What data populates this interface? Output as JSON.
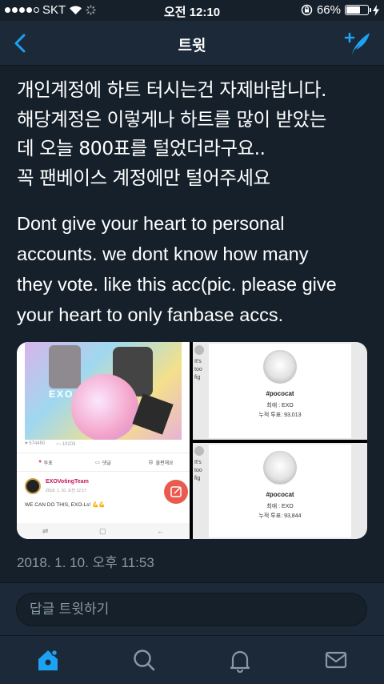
{
  "status_bar": {
    "carrier": "SKT",
    "time": "오전 12:10",
    "battery": "66%",
    "battery_level": 0.66,
    "signal_bars": 4
  },
  "nav": {
    "title": "트윗",
    "icons": {
      "back": "chevron-left-icon",
      "compose": "compose-tweet-icon"
    }
  },
  "tweet": {
    "text_ko": [
      "개인계정에 하트 터시는건 자제바랍니다.",
      "해당계정은 이렇게나 하트를 많이 받았는",
      "데 오늘 800표를 털었더라구요..",
      "꼭 팬베이스 계정에만 털어주세요"
    ],
    "text_en": [
      "Dont give your heart to personal",
      "accounts. we dont know how many",
      "they vote. like this acc(pic. please give",
      "your heart to only fanbase accs."
    ],
    "timestamp": "2018. 1. 10. 오후 11:53"
  },
  "media": {
    "left": {
      "art_label": "EXO",
      "stat_hearts": "574450",
      "stat_comments": "10103",
      "actions": [
        "투표",
        "댓글",
        "불편해요"
      ],
      "post_user": "EXOVotingTeam",
      "post_date": "2018. 1. 10. 오전 12:17",
      "post_text": "WE CAN DO THIS, EXO-Ls! 💪💪"
    },
    "right_top": {
      "handle": "#pococat",
      "bias": "최애 : EXO",
      "votes": "누적 투표: 93,013",
      "peek_lines": [
        "It's",
        "too",
        "fig"
      ]
    },
    "right_bottom": {
      "handle": "#pococat",
      "bias": "최애 : EXO",
      "votes": "누적 투표: 93,844",
      "peek_lines": [
        "It's",
        "too",
        "fig"
      ]
    }
  },
  "reply": {
    "placeholder": "답글 트윗하기"
  },
  "tabs": [
    "home-icon",
    "search-icon",
    "notifications-bell-icon",
    "messages-envelope-icon"
  ],
  "colors": {
    "background": "#15202b",
    "bar": "#1c2938",
    "accent": "#1da1f2",
    "muted": "#8899a6"
  }
}
